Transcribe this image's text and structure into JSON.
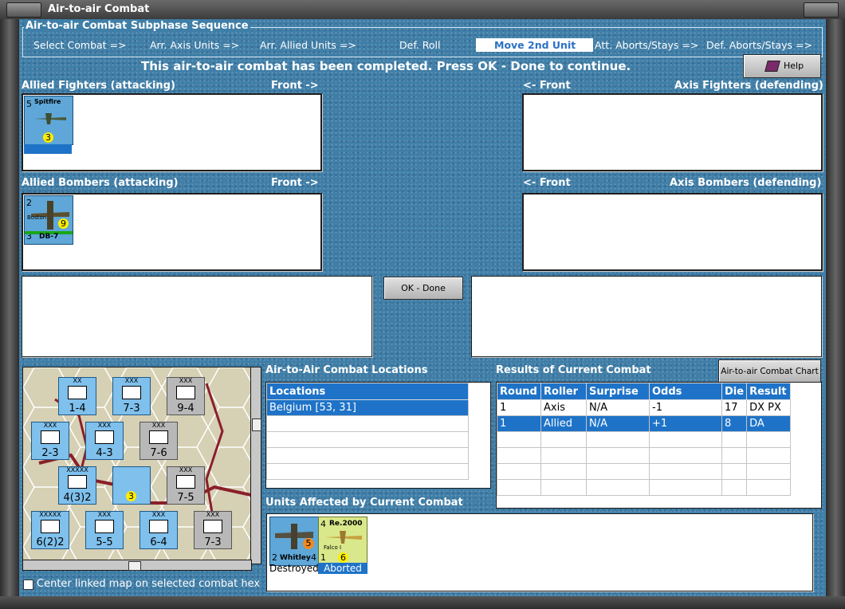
{
  "window": {
    "title": "Air-to-air Combat"
  },
  "sequence": {
    "legend": "Air-to-air Combat Subphase Sequence",
    "steps": [
      "Select Combat =>",
      "Arr. Axis Units =>",
      "Arr. Allied Units =>",
      "Def. Roll",
      "Move 2nd Unit",
      "Att. Aborts/Stays =>",
      "Def. Aborts/Stays =>"
    ],
    "active_index": 4
  },
  "status_message": "This air-to-air combat has been completed.  Press OK - Done to continue.",
  "buttons": {
    "help": "Help",
    "ok_done": "OK - Done",
    "chart": "Air-to-air Combat Chart"
  },
  "panels": {
    "allied_fighters": {
      "title": "Allied Fighters (attacking)",
      "front": "Front ->"
    },
    "axis_fighters": {
      "title": "Axis Fighters (defending)",
      "front": "<- Front"
    },
    "allied_bombers": {
      "title": "Allied Bombers (attacking)",
      "front": "Front ->"
    },
    "axis_bombers": {
      "title": "Axis Bombers (defending)",
      "front": "<- Front"
    }
  },
  "units": {
    "spitfire": {
      "name": "Spitfire",
      "top_left": "5",
      "value": "3"
    },
    "boston": {
      "name": "Boston",
      "top_left": "2",
      "bottom_left": "3",
      "value": "9",
      "label": "DB-7"
    },
    "whitley": {
      "name": "Whitley",
      "left": "2",
      "right": "4",
      "value": "5",
      "status": "Destroyed"
    },
    "re2000": {
      "name": "Re.2000",
      "sub": "Falco I",
      "top_left": "4",
      "bottom_left": "1",
      "value": "6",
      "status": "Aborted"
    }
  },
  "locations": {
    "title": "Air-to-Air Combat Locations",
    "header": "Locations",
    "rows": [
      "Belgium [53, 31]"
    ]
  },
  "results": {
    "title": "Results of Current Combat",
    "columns": [
      "Round",
      "Roller",
      "Surprise",
      "Odds",
      "Die",
      "Result"
    ],
    "rows": [
      [
        "1",
        "Axis",
        "N/A",
        "-1",
        "17",
        "DX PX"
      ],
      [
        "1",
        "Allied",
        "N/A",
        "+1",
        "8",
        "DA"
      ]
    ],
    "selected_row": 1
  },
  "affected": {
    "title": "Units Affected by Current Combat"
  },
  "map": {
    "center_checkbox_label": "Center linked map on selected combat hex",
    "checked": false,
    "counters": [
      {
        "size": "XX",
        "value": "1-4",
        "tone": "blue"
      },
      {
        "size": "XXX",
        "value": "7-3",
        "tone": "blue"
      },
      {
        "size": "XXX",
        "value": "9-4",
        "tone": "grey"
      },
      {
        "size": "XXX",
        "value": "2-3",
        "tone": "blue"
      },
      {
        "size": "XXX",
        "value": "4-3",
        "tone": "blue"
      },
      {
        "size": "XXX",
        "value": "7-6",
        "tone": "grey"
      },
      {
        "size": "XXXXX",
        "value": "4(3)2",
        "tone": "blue"
      },
      {
        "size": "XXX",
        "value": "7-5",
        "tone": "grey"
      },
      {
        "size": "XXXXX",
        "value": "6(2)2",
        "tone": "blue"
      },
      {
        "size": "XXX",
        "value": "5-5",
        "tone": "blue"
      },
      {
        "size": "XXX",
        "value": "6-4",
        "tone": "blue"
      },
      {
        "size": "XXX",
        "value": "7-3",
        "tone": "grey"
      }
    ]
  },
  "colors": {
    "background": "#3f7ea7",
    "selection": "#1e73c8",
    "counter_yellow": "#ffee00"
  }
}
